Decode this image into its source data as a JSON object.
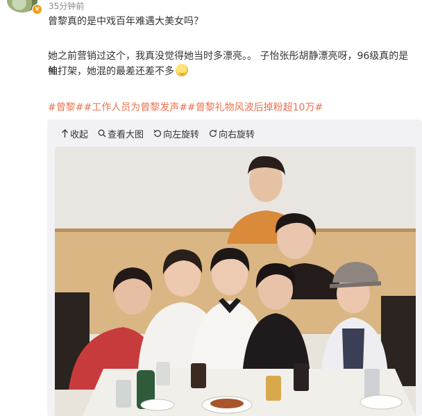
{
  "post": {
    "time": "35分钟前",
    "text_line1": "曾黎真的是中戏百年难遇大美女吗？",
    "text_line2": "她之前营销过这个，我真没觉得她当时多漂亮。。 子怡张彤胡静漂亮呀，96级真的是神",
    "text_line3": "仙打架，她混的最差还差不多",
    "tags": "#曾黎##工作人员为曾黎发声##曾黎礼物风波后掉粉超10万#"
  },
  "toolbar": {
    "collapse_label": "收起",
    "view_large_label": "查看大图",
    "rotate_left_label": "向左旋转",
    "rotate_right_label": "向右旋转"
  },
  "icons": {
    "collapse": "arrow-up-icon",
    "view_large": "magnifier-icon",
    "rotate_left": "rotate-left-icon",
    "rotate_right": "rotate-right-icon",
    "verified": "verified-badge-icon",
    "emoji": "emoji-icon"
  },
  "colors": {
    "tag": "#eb7350",
    "time": "#8b8b8b",
    "card_bg": "#f2f2f5",
    "verified_badge": "#f0a020"
  },
  "photo": {
    "description_alt": "group photo"
  }
}
